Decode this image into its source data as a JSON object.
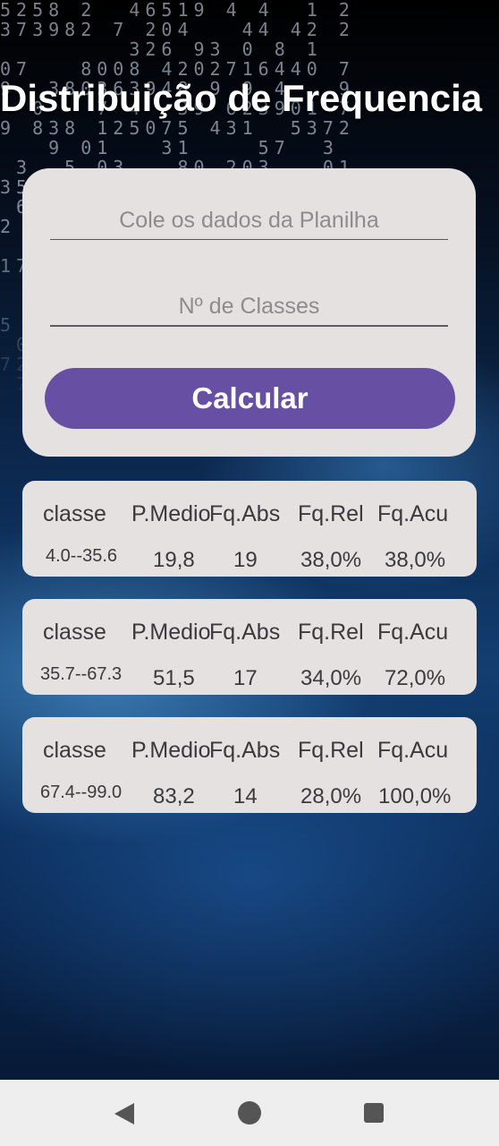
{
  "app": {
    "title": "Distribuição de Frequencia"
  },
  "form": {
    "data_placeholder": "Cole os dados da Planilha",
    "classes_placeholder": "Nº de Classes",
    "calc_label": "Calcular"
  },
  "table": {
    "headers": [
      "classe",
      "P.Medio",
      "Fq.Abs",
      "Fq.Rel",
      "Fq.Acu"
    ],
    "rows": [
      {
        "classe": "4.0--35.6",
        "pmedio": "19,8",
        "fqabs": "19",
        "fqrel": "38,0%",
        "fqacu": "38,0%"
      },
      {
        "classe": "35.7--67.3",
        "pmedio": "51,5",
        "fqabs": "17",
        "fqrel": "34,0%",
        "fqacu": "72,0%"
      },
      {
        "classe": "67.4--99.0",
        "pmedio": "83,2",
        "fqabs": "14",
        "fqrel": "28,0%",
        "fqacu": "100,0%"
      }
    ]
  },
  "navbar": {
    "icons": [
      "back-icon",
      "home-icon",
      "recent-apps-icon"
    ]
  },
  "colors": {
    "accent": "#6750a4",
    "card": "#e6e1e1",
    "title": "#ffffff"
  }
}
